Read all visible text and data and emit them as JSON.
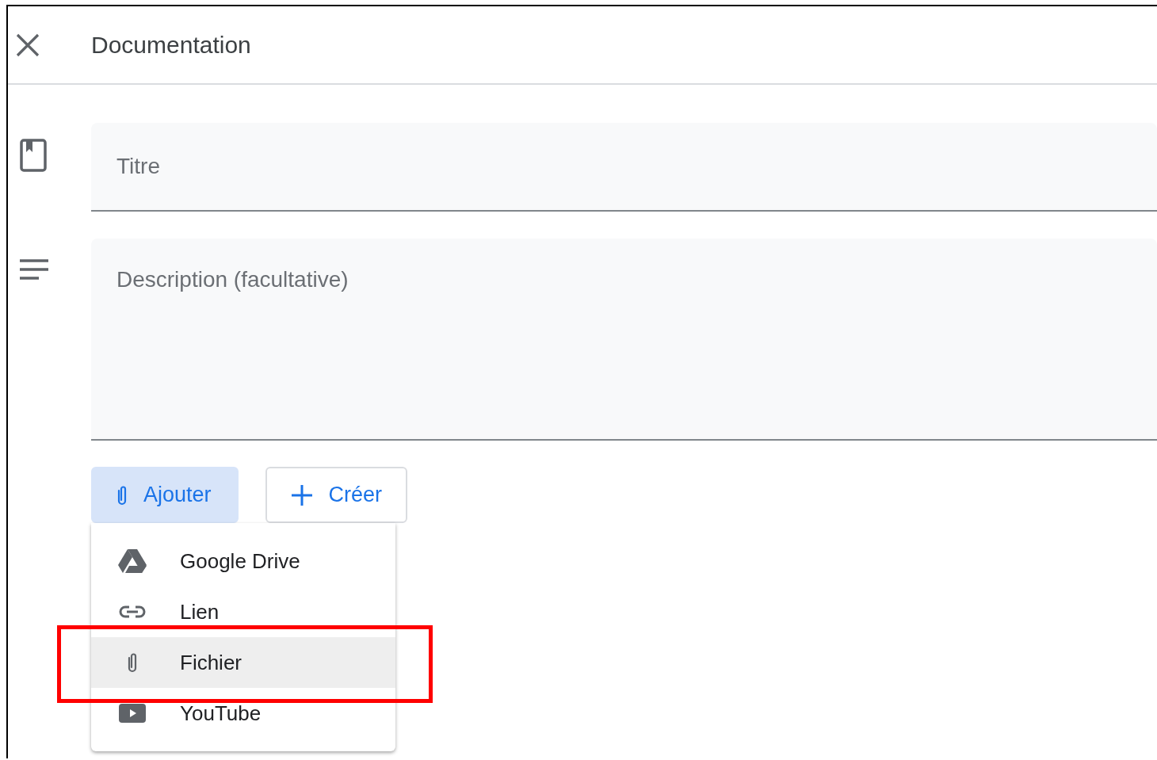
{
  "header": {
    "title": "Documentation"
  },
  "fields": [
    {
      "kind": "title",
      "placeholder": "Titre"
    },
    {
      "kind": "description",
      "placeholder": "Description (facultative)"
    }
  ],
  "buttons": [
    {
      "kind": "attach",
      "label": "Ajouter",
      "selected": true
    },
    {
      "kind": "create",
      "label": "Créer",
      "selected": false
    }
  ],
  "menu": [
    {
      "kind": "drive",
      "label": "Google Drive",
      "selected": false
    },
    {
      "kind": "link",
      "label": "Lien",
      "selected": false
    },
    {
      "kind": "file",
      "label": "Fichier",
      "selected": true
    },
    {
      "kind": "youtube",
      "label": "YouTube",
      "selected": false
    }
  ],
  "annotation": {
    "kind": "frame",
    "color": "#ff0000"
  }
}
